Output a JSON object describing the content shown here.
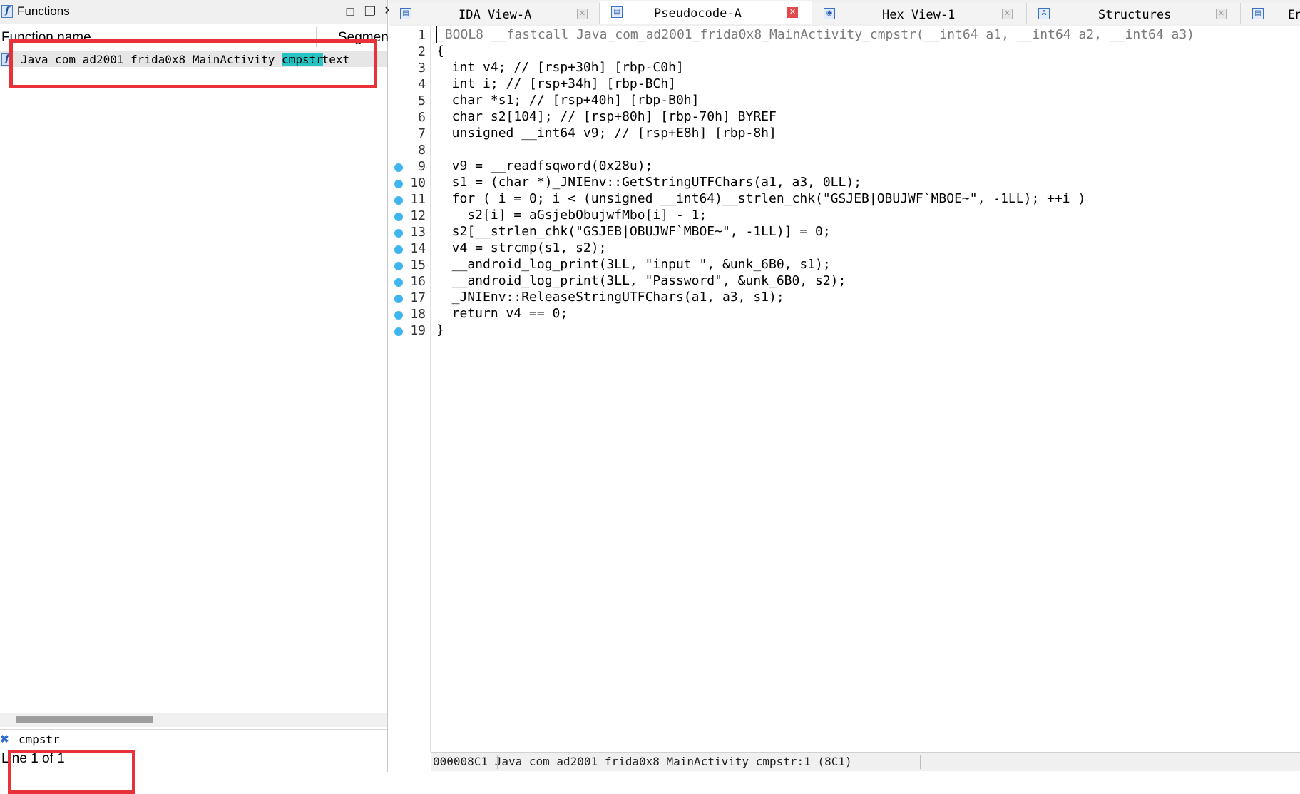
{
  "functions_panel": {
    "title": "Functions",
    "columns": {
      "name": "Function name",
      "segment": "Segment"
    },
    "rows": [
      {
        "name_prefix": "Java_com_ad2001_frida0x8_MainActivity_",
        "name_match": "cmpstr",
        "segment": ".text"
      }
    ],
    "filter_value": "cmpstr",
    "status": "Line 1 of 1"
  },
  "tabs": [
    {
      "label": "IDA View-A",
      "active": false
    },
    {
      "label": "Pseudocode-A",
      "active": true
    },
    {
      "label": "Hex View-1",
      "active": false
    },
    {
      "label": "Structures",
      "active": false
    },
    {
      "label": "En",
      "active": false
    }
  ],
  "pseudocode": {
    "line_numbers": [
      "1",
      "2",
      "3",
      "4",
      "5",
      "6",
      "7",
      "8",
      "9",
      "10",
      "11",
      "12",
      "13",
      "14",
      "15",
      "16",
      "17",
      "18",
      "19"
    ],
    "lines": [
      "_BOOL8 __fastcall Java_com_ad2001_frida0x8_MainActivity_cmpstr(__int64 a1, __int64 a2, __int64 a3)",
      "{",
      "  int v4; // [rsp+30h] [rbp-C0h]",
      "  int i; // [rsp+34h] [rbp-BCh]",
      "  char *s1; // [rsp+40h] [rbp-B0h]",
      "  char s2[104]; // [rsp+80h] [rbp-70h] BYREF",
      "  unsigned __int64 v9; // [rsp+E8h] [rbp-8h]",
      "",
      "  v9 = __readfsqword(0x28u);",
      "  s1 = (char *)_JNIEnv::GetStringUTFChars(a1, a3, 0LL);",
      "  for ( i = 0; i < (unsigned __int64)__strlen_chk(\"GSJEB|OBUJWF`MBOE~\", -1LL); ++i )",
      "    s2[i] = aGsjebObujwfMbo[i] - 1;",
      "  s2[__strlen_chk(\"GSJEB|OBUJWF`MBOE~\", -1LL)] = 0;",
      "  v4 = strcmp(s1, s2);",
      "  __android_log_print(3LL, \"input \", &unk_6B0, s1);",
      "  __android_log_print(3LL, \"Password\", &unk_6B0, s2);",
      "  _JNIEnv::ReleaseStringUTFChars(a1, a3, s1);",
      "  return v4 == 0;",
      "}"
    ]
  },
  "status_bar": {
    "address": "000008C1",
    "location": "Java_com_ad2001_frida0x8_MainActivity_cmpstr:1 (8C1)"
  },
  "colors": {
    "highlight": "#28c3c3",
    "annotation_box": "#e8323a",
    "breakpoint": "#3fb5f0"
  }
}
